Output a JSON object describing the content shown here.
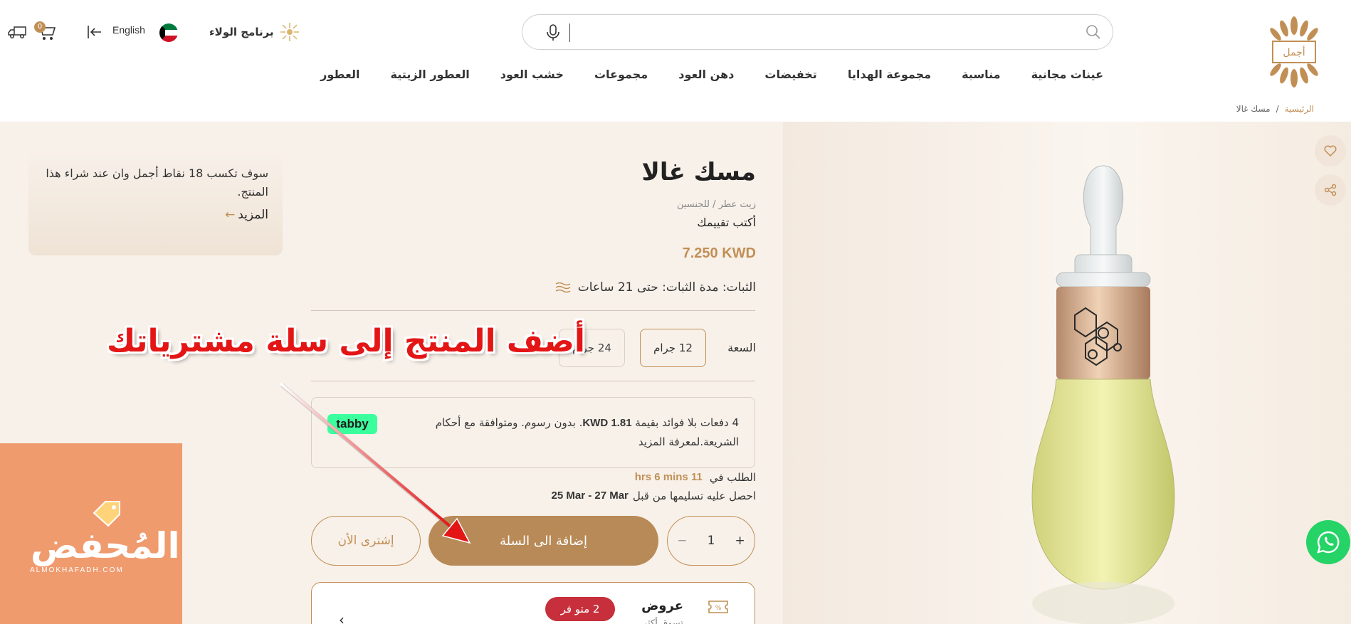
{
  "header": {
    "logo_alt": "أجمل",
    "search_placeholder": "",
    "loyalty_label": "برنامج الولاء",
    "language": "English",
    "cart_count": "0"
  },
  "nav": {
    "items": [
      "العطور",
      "العطور الزيتية",
      "خشب العود",
      "مجموعات",
      "دهن العود",
      "تخفيضات",
      "مجموعة الهدايا",
      "مناسبة",
      "عينات مجانية"
    ]
  },
  "breadcrumb": {
    "home": "الرئيسية",
    "separator": "/",
    "current": "مسك غالا"
  },
  "product": {
    "title": "مسك غالا",
    "subtitle": "زيت عطر / للجنسين",
    "review_link": "أكتب تقييمك",
    "price": "7.250 KWD",
    "longevity": "الثبات: مدة الثبات: حتى 21 ساعات",
    "size_label": "السعة",
    "sizes": [
      "12 جرام",
      "24 جرام"
    ],
    "selected_size": "12 جرام",
    "tabby_text_before": "4 دفعات بلا فوائد بقيمة",
    "tabby_amount": "1.81 KWD",
    "tabby_text_after": ". بدون رسوم. ومتوافقة مع أحكام الشريعة.لمعرفة المزيد",
    "tabby_logo": "tabby",
    "order_label": "الطلب في",
    "order_time": "11 hrs 6 mins",
    "delivery_label": "احصل عليه تسليمها من قبل",
    "delivery_dates": "25 Mar - 27 Mar",
    "quantity": "1",
    "qty_minus": "−",
    "qty_plus": "+",
    "add_to_cart": "إضافة الى السلة",
    "buy_now": "إشترى الأن"
  },
  "loyalty_card": {
    "message": "سوف تكسب 18 نقاط أجمل وان عند شراء هذا المنتج.",
    "more": "المزيد"
  },
  "offers": {
    "title": "عروض",
    "subtitle": "تسوق أكثر",
    "badge": "2 متو فر"
  },
  "annotation": {
    "text": "أضف المنتج إلى سلة مشترياتك"
  },
  "watermark": {
    "name": "المُحفض",
    "url": "ALMOKHAFADH.COM"
  },
  "colors": {
    "accent": "#c18f55",
    "button": "#b88a57",
    "annotation": "#e41515",
    "watermark_bg": "#f09b6e",
    "whatsapp": "#25d366",
    "offer_badge": "#c62f3b"
  }
}
